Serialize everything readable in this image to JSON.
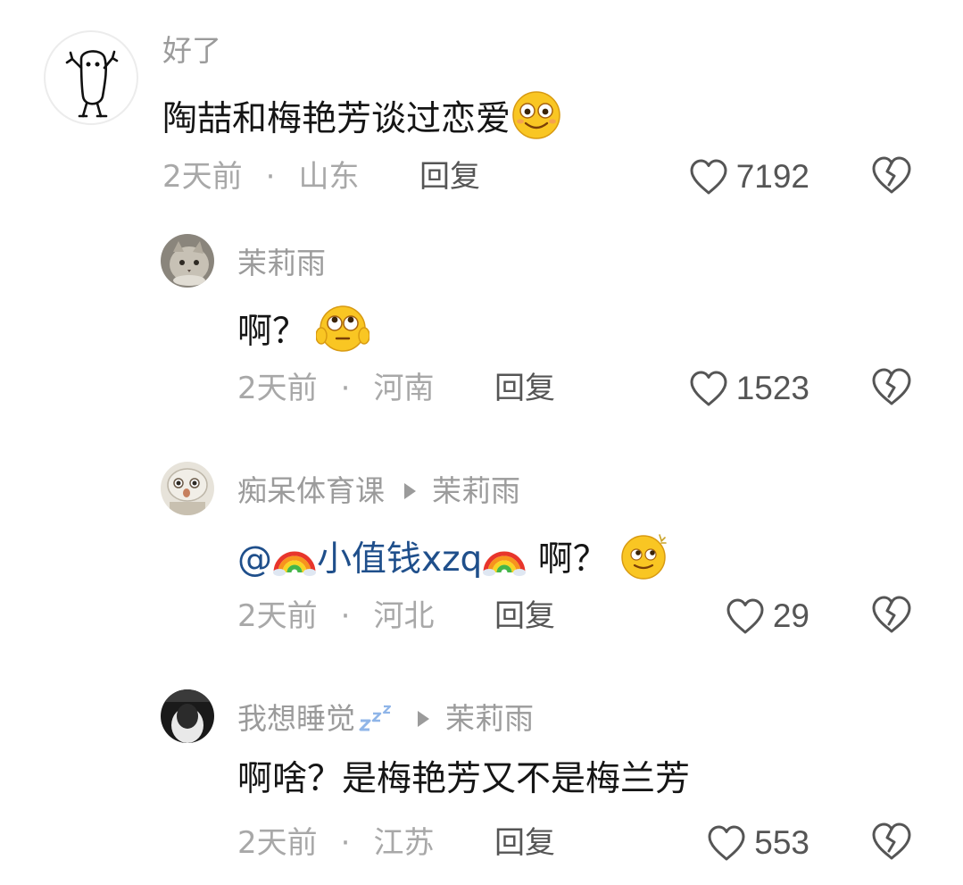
{
  "comments": [
    {
      "author": "好了",
      "text": "陶喆和梅艳芳谈过恋爱",
      "time": "2天前",
      "location": "山东",
      "reply_label": "回复",
      "likes": "7192"
    },
    {
      "author": "茉莉雨",
      "text": "啊？",
      "time": "2天前",
      "location": "河南",
      "reply_label": "回复",
      "likes": "1523"
    },
    {
      "author": "痴呆体育课",
      "reply_to": "茉莉雨",
      "mention_prefix": "@",
      "mention_name": "小值钱xzq",
      "text": " 啊？",
      "time": "2天前",
      "location": "河北",
      "reply_label": "回复",
      "likes": "29"
    },
    {
      "author": "我想睡觉",
      "reply_to": "茉莉雨",
      "text": "啊啥？是梅艳芳又不是梅兰芳",
      "time": "2天前",
      "location": "江苏",
      "reply_label": "回复",
      "likes": "553"
    }
  ],
  "meta_separator": "·",
  "colors": {
    "name": "#9b9b9b",
    "meta": "#a8a8a8",
    "text": "#151515",
    "mention": "#1f4f8b",
    "icon": "#555555"
  },
  "icons": [
    "heart-outline-icon",
    "broken-heart-icon",
    "reply-arrow-icon",
    "rainbow-emoji",
    "smile-emoji",
    "rolling-eyes-emoji",
    "zzz-emoji"
  ]
}
